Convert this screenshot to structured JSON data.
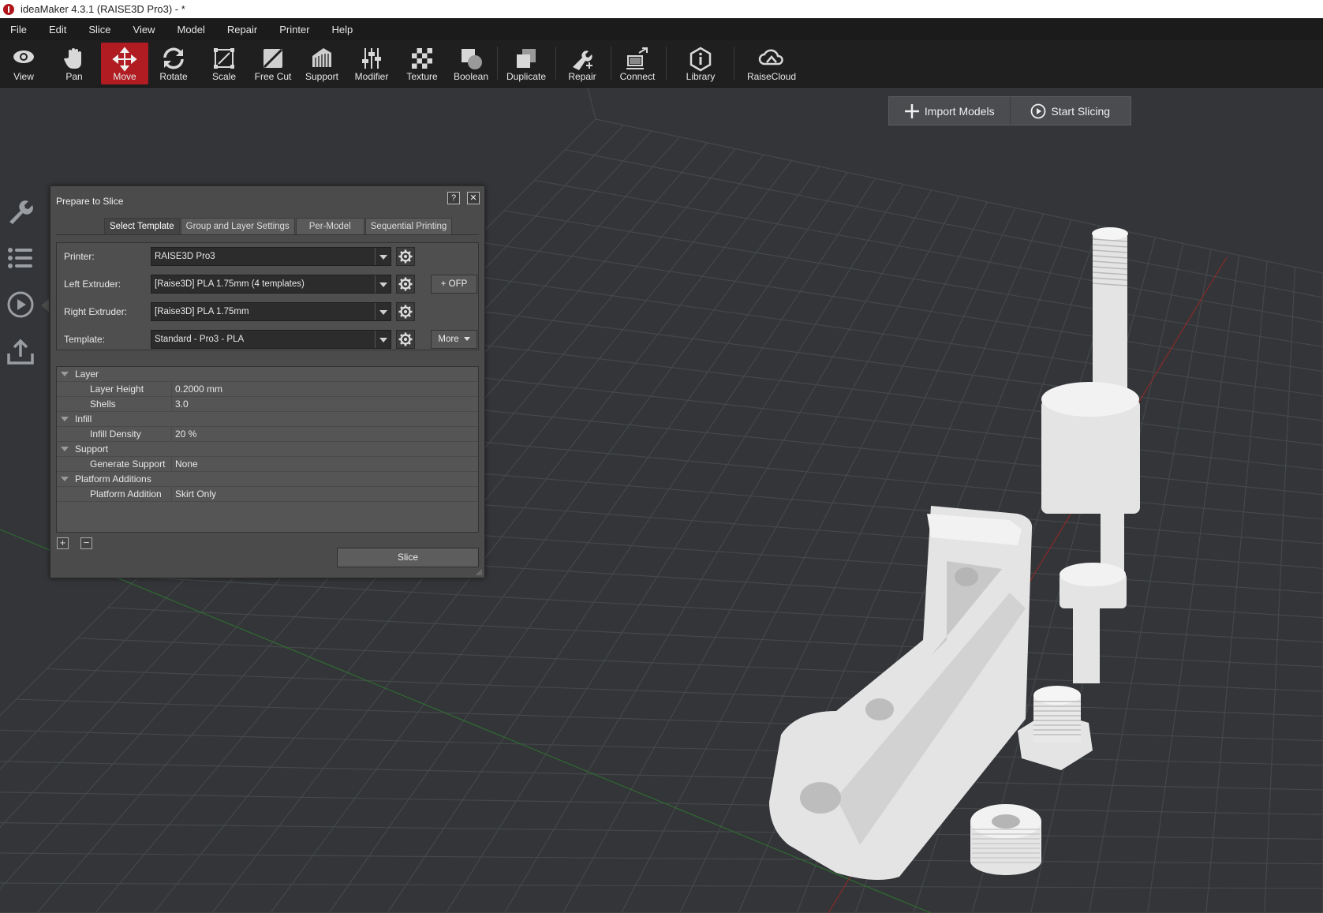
{
  "window": {
    "title": "ideaMaker 4.3.1 (RAISE3D Pro3) - *"
  },
  "menu": [
    "File",
    "Edit",
    "Slice",
    "View",
    "Model",
    "Repair",
    "Printer",
    "Help"
  ],
  "toolbar": {
    "view": "View",
    "pan": "Pan",
    "move": "Move",
    "rotate": "Rotate",
    "scale": "Scale",
    "free_cut": "Free Cut",
    "support": "Support",
    "modifier": "Modifier",
    "texture": "Texture",
    "boolean": "Boolean",
    "duplicate": "Duplicate",
    "repair": "Repair",
    "connect": "Connect",
    "library": "Library",
    "raisecloud": "RaiseCloud",
    "active": "Move"
  },
  "actions": {
    "import": "Import Models",
    "start": "Start Slicing"
  },
  "dialog": {
    "title": "Prepare to Slice",
    "help": "?",
    "close": "✕",
    "tabs": [
      "Select Template",
      "Group and Layer Settings",
      "Per-Model",
      "Sequential Printing"
    ],
    "active_tab": "Select Template",
    "printer": {
      "label": "Printer:",
      "value": "RAISE3D Pro3"
    },
    "left_extruder": {
      "label": "Left Extruder:",
      "value": "[Raise3D] PLA 1.75mm (4 templates)"
    },
    "right_extruder": {
      "label": "Right Extruder:",
      "value": "[Raise3D] PLA 1.75mm"
    },
    "template": {
      "label": "Template:",
      "value": "Standard - Pro3 - PLA"
    },
    "ofp_button": "+ OFP",
    "more_button": "More",
    "settings": {
      "layer": "Layer",
      "layer_height_label": "Layer Height",
      "layer_height_value": "0.2000 mm",
      "shells_label": "Shells",
      "shells_value": "3.0",
      "infill": "Infill",
      "infill_density_label": "Infill Density",
      "infill_density_value": "20 %",
      "support": "Support",
      "generate_support_label": "Generate Support",
      "generate_support_value": "None",
      "platform_additions": "Platform Additions",
      "platform_addition_label": "Platform Addition",
      "platform_addition_value": "Skirt Only"
    },
    "add": "+",
    "remove": "−",
    "slice_button": "Slice"
  },
  "colors": {
    "accent": "#b01c22",
    "background": "#333538",
    "grid": "#45484b",
    "model": "#e4e4e4"
  },
  "icons": [
    "view-icon",
    "pan-icon",
    "move-icon",
    "rotate-icon",
    "scale-icon",
    "free-cut-icon",
    "support-icon",
    "modifier-icon",
    "texture-icon",
    "boolean-icon",
    "duplicate-icon",
    "repair-icon",
    "connect-icon",
    "library-icon",
    "raisecloud-icon",
    "wrench-icon",
    "list-icon",
    "play-icon",
    "upload-icon",
    "gear-icon",
    "plus-icon"
  ]
}
